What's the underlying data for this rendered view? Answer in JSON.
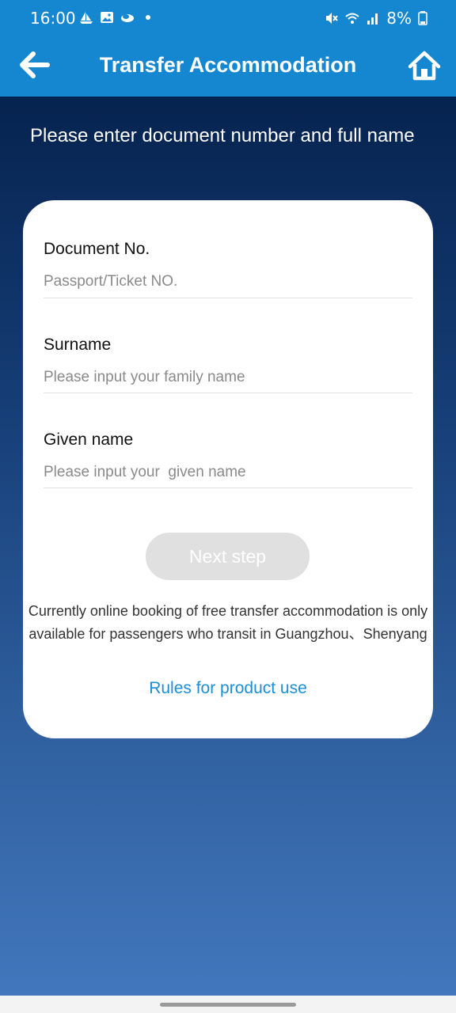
{
  "status_bar": {
    "time": "16:00",
    "battery": "8%",
    "left_icons": [
      "sailboat-icon",
      "image-icon",
      "cloud-icon"
    ],
    "right_icons": [
      "mute-icon",
      "wifi-icon",
      "signal-icon",
      "battery-icon"
    ]
  },
  "app_bar": {
    "title": "Transfer Accommodation",
    "back_icon": "arrow-left-icon",
    "home_icon": "home-icon"
  },
  "instruction": "Please enter document number and full name",
  "form": {
    "document": {
      "label": "Document No.",
      "placeholder": "Passport/Ticket NO.",
      "value": ""
    },
    "surname": {
      "label": "Surname",
      "placeholder": "Please input your family name",
      "value": ""
    },
    "given_name": {
      "label": "Given name",
      "placeholder": "Please input your  given name",
      "value": ""
    },
    "next_button": "Next step"
  },
  "notice": "Currently online booking of free transfer accommodation is only available for passengers who transit in Guangzhou、Shenyang",
  "rules_link": "Rules for product use",
  "colors": {
    "header": "#1487d0",
    "gradient_top": "#06234f",
    "gradient_bottom": "#4277bd",
    "link": "#1a8fd6",
    "button_disabled": "#e0e0e0"
  }
}
